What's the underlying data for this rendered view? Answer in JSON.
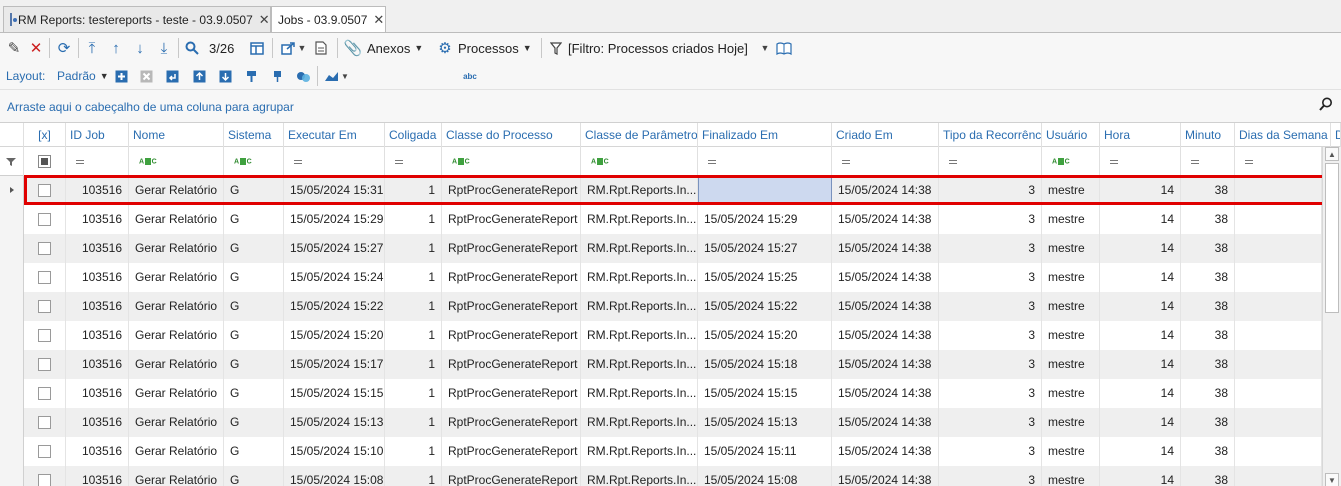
{
  "tabs": [
    {
      "label": "RM Reports: testereports - teste - 03.9.0507",
      "close": "✕"
    },
    {
      "label": "Jobs - 03.9.0507",
      "close": "✕"
    }
  ],
  "toolbar": {
    "record_position": "3/26",
    "anexos_label": "Anexos",
    "processos_label": "Processos",
    "filter_label": "[Filtro: Processos criados Hoje]"
  },
  "layout_bar": {
    "layout_label": "Layout:",
    "layout_value": "Padrão"
  },
  "group_hint": "Arraste aqui o cabeçalho de uma coluna para agrupar",
  "columns": [
    "[x]",
    "ID Job",
    "Nome",
    "Sistema",
    "Executar Em",
    "Coligada",
    "Classe do Processo",
    "Classe de Parâmetros",
    "Finalizado Em",
    "Criado Em",
    "Tipo da Recorrência",
    "Usuário",
    "Hora",
    "Minuto",
    "Dias da Semana",
    "D"
  ],
  "rows": [
    {
      "id": "103516",
      "nome": "Gerar Relatório",
      "sistema": "G",
      "executar": "15/05/2024 15:31",
      "coligada": "1",
      "classe": "RptProcGenerateReport",
      "param": "RM.Rpt.Reports.In...",
      "finalizado": "",
      "criado": "15/05/2024 14:38",
      "tipo": "3",
      "usuario": "mestre",
      "hora": "14",
      "minuto": "38"
    },
    {
      "id": "103516",
      "nome": "Gerar Relatório",
      "sistema": "G",
      "executar": "15/05/2024 15:29",
      "coligada": "1",
      "classe": "RptProcGenerateReport",
      "param": "RM.Rpt.Reports.In...",
      "finalizado": "15/05/2024 15:29",
      "criado": "15/05/2024 14:38",
      "tipo": "3",
      "usuario": "mestre",
      "hora": "14",
      "minuto": "38"
    },
    {
      "id": "103516",
      "nome": "Gerar Relatório",
      "sistema": "G",
      "executar": "15/05/2024 15:27",
      "coligada": "1",
      "classe": "RptProcGenerateReport",
      "param": "RM.Rpt.Reports.In...",
      "finalizado": "15/05/2024 15:27",
      "criado": "15/05/2024 14:38",
      "tipo": "3",
      "usuario": "mestre",
      "hora": "14",
      "minuto": "38"
    },
    {
      "id": "103516",
      "nome": "Gerar Relatório",
      "sistema": "G",
      "executar": "15/05/2024 15:24",
      "coligada": "1",
      "classe": "RptProcGenerateReport",
      "param": "RM.Rpt.Reports.In...",
      "finalizado": "15/05/2024 15:25",
      "criado": "15/05/2024 14:38",
      "tipo": "3",
      "usuario": "mestre",
      "hora": "14",
      "minuto": "38"
    },
    {
      "id": "103516",
      "nome": "Gerar Relatório",
      "sistema": "G",
      "executar": "15/05/2024 15:22",
      "coligada": "1",
      "classe": "RptProcGenerateReport",
      "param": "RM.Rpt.Reports.In...",
      "finalizado": "15/05/2024 15:22",
      "criado": "15/05/2024 14:38",
      "tipo": "3",
      "usuario": "mestre",
      "hora": "14",
      "minuto": "38"
    },
    {
      "id": "103516",
      "nome": "Gerar Relatório",
      "sistema": "G",
      "executar": "15/05/2024 15:20",
      "coligada": "1",
      "classe": "RptProcGenerateReport",
      "param": "RM.Rpt.Reports.In...",
      "finalizado": "15/05/2024 15:20",
      "criado": "15/05/2024 14:38",
      "tipo": "3",
      "usuario": "mestre",
      "hora": "14",
      "minuto": "38"
    },
    {
      "id": "103516",
      "nome": "Gerar Relatório",
      "sistema": "G",
      "executar": "15/05/2024 15:17",
      "coligada": "1",
      "classe": "RptProcGenerateReport",
      "param": "RM.Rpt.Reports.In...",
      "finalizado": "15/05/2024 15:18",
      "criado": "15/05/2024 14:38",
      "tipo": "3",
      "usuario": "mestre",
      "hora": "14",
      "minuto": "38"
    },
    {
      "id": "103516",
      "nome": "Gerar Relatório",
      "sistema": "G",
      "executar": "15/05/2024 15:15",
      "coligada": "1",
      "classe": "RptProcGenerateReport",
      "param": "RM.Rpt.Reports.In...",
      "finalizado": "15/05/2024 15:15",
      "criado": "15/05/2024 14:38",
      "tipo": "3",
      "usuario": "mestre",
      "hora": "14",
      "minuto": "38"
    },
    {
      "id": "103516",
      "nome": "Gerar Relatório",
      "sistema": "G",
      "executar": "15/05/2024 15:13",
      "coligada": "1",
      "classe": "RptProcGenerateReport",
      "param": "RM.Rpt.Reports.In...",
      "finalizado": "15/05/2024 15:13",
      "criado": "15/05/2024 14:38",
      "tipo": "3",
      "usuario": "mestre",
      "hora": "14",
      "minuto": "38"
    },
    {
      "id": "103516",
      "nome": "Gerar Relatório",
      "sistema": "G",
      "executar": "15/05/2024 15:10",
      "coligada": "1",
      "classe": "RptProcGenerateReport",
      "param": "RM.Rpt.Reports.In...",
      "finalizado": "15/05/2024 15:11",
      "criado": "15/05/2024 14:38",
      "tipo": "3",
      "usuario": "mestre",
      "hora": "14",
      "minuto": "38"
    },
    {
      "id": "103516",
      "nome": "Gerar Relatório",
      "sistema": "G",
      "executar": "15/05/2024 15:08",
      "coligada": "1",
      "classe": "RptProcGenerateReport",
      "param": "RM.Rpt.Reports.In...",
      "finalizado": "15/05/2024 15:08",
      "criado": "15/05/2024 14:38",
      "tipo": "3",
      "usuario": "mestre",
      "hora": "14",
      "minuto": "38"
    }
  ],
  "colors": {
    "accent": "#2a6db0",
    "highlight_border": "#e00000",
    "alt_row": "#efefef",
    "selected_cell": "#cdd9ef"
  }
}
